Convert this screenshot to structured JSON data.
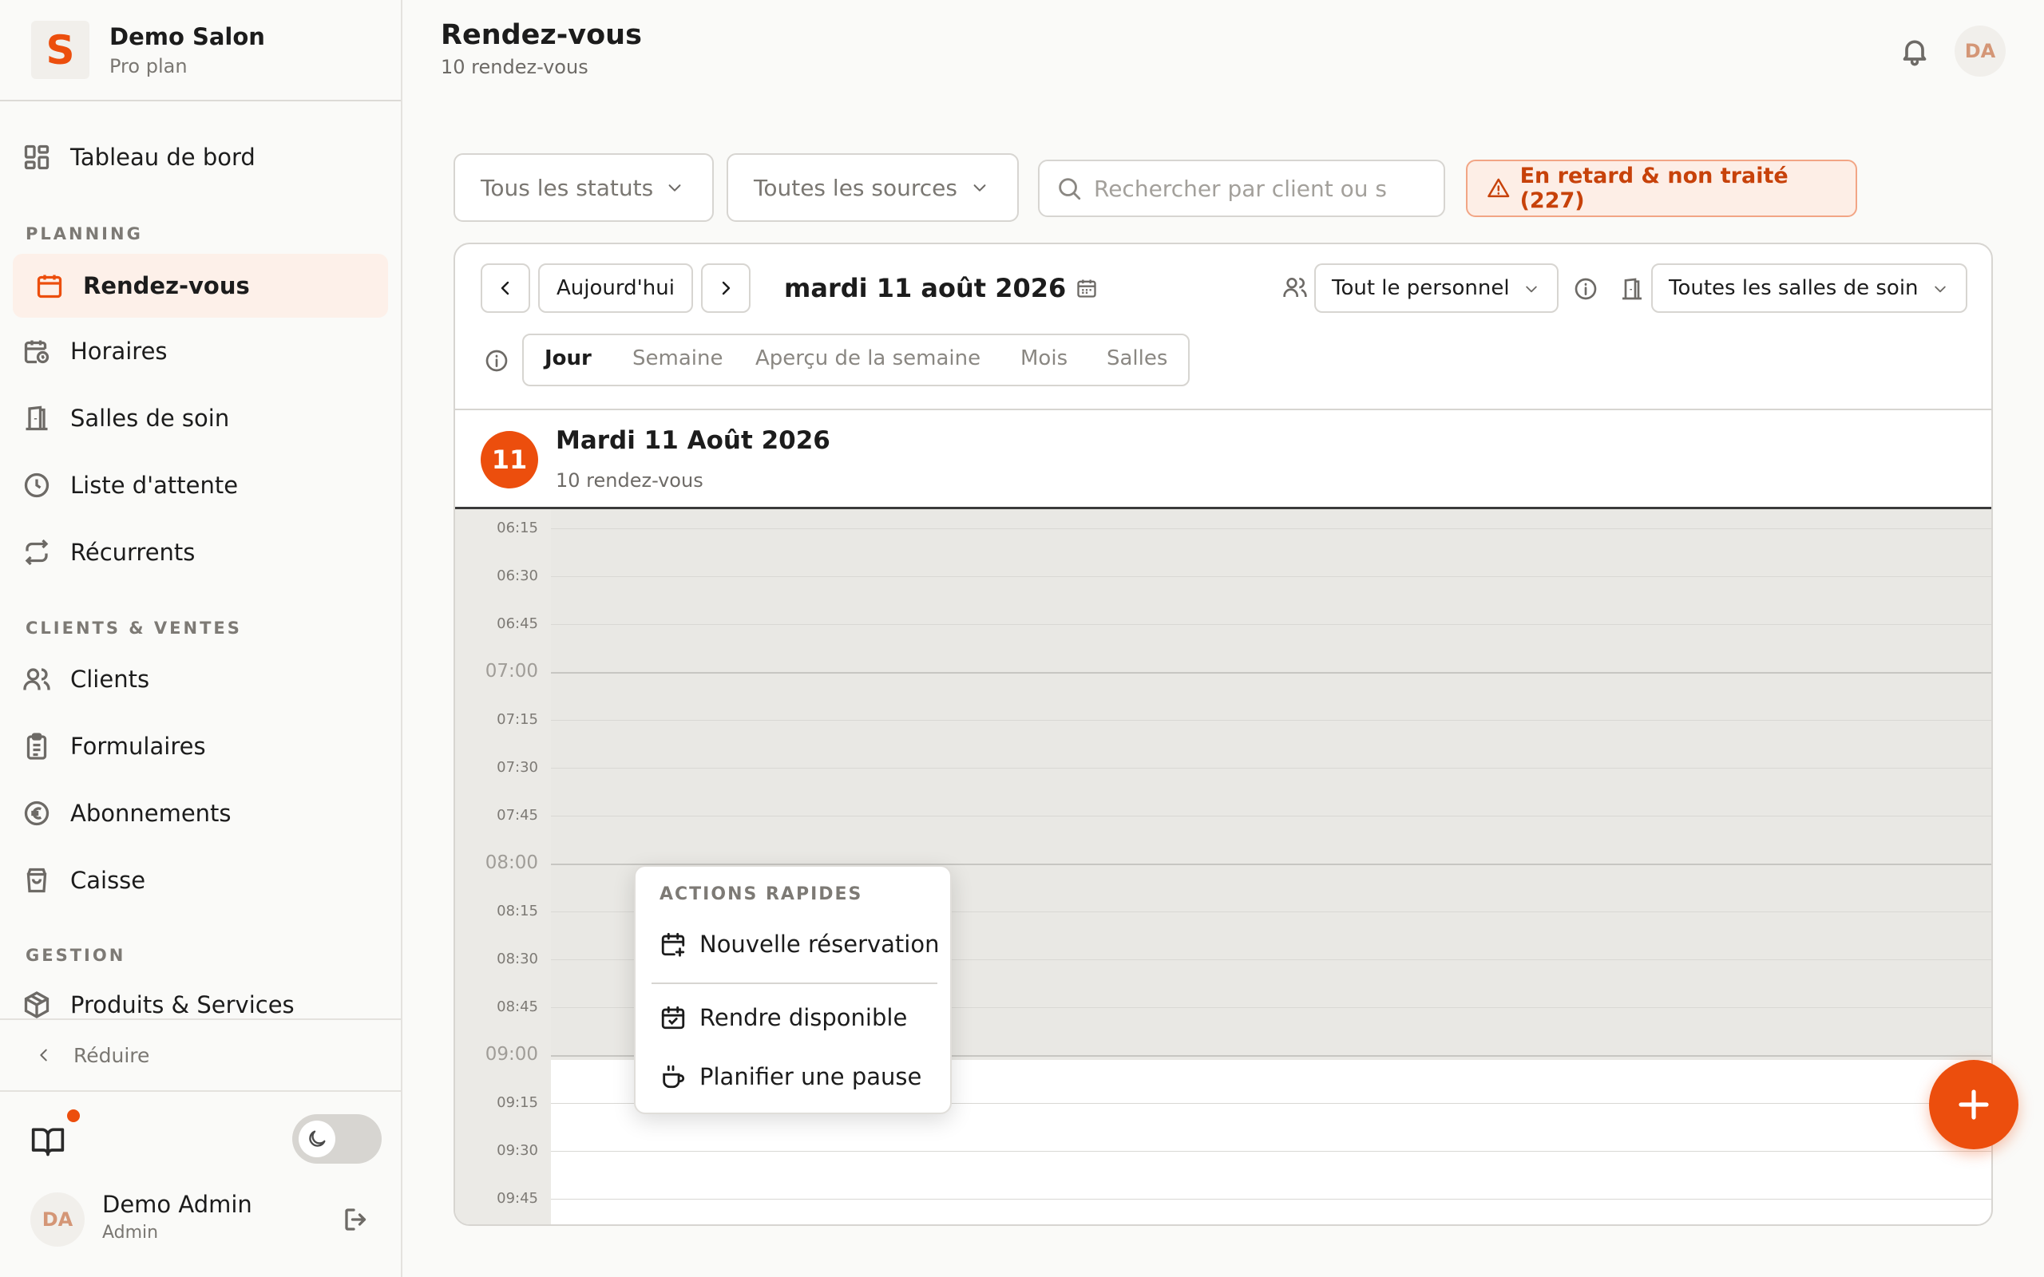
{
  "brand": {
    "logo_letter": "S",
    "name": "Demo Salon",
    "plan": "Pro plan"
  },
  "sidebar": {
    "top_item": {
      "label": "Tableau de bord",
      "icon": "dashboard-icon"
    },
    "sections": [
      {
        "title": "PLANNING",
        "items": [
          {
            "label": "Rendez-vous",
            "icon": "calendar-icon",
            "active": true
          },
          {
            "label": "Horaires",
            "icon": "calendar-clock-icon"
          },
          {
            "label": "Salles de soin",
            "icon": "door-icon"
          },
          {
            "label": "Liste d'attente",
            "icon": "clock-icon"
          },
          {
            "label": "Récurrents",
            "icon": "repeat-icon"
          }
        ]
      },
      {
        "title": "CLIENTS & VENTES",
        "items": [
          {
            "label": "Clients",
            "icon": "users-icon"
          },
          {
            "label": "Formulaires",
            "icon": "clipboard-icon"
          },
          {
            "label": "Abonnements",
            "icon": "euro-icon"
          },
          {
            "label": "Caisse",
            "icon": "shopping-bag-icon"
          }
        ]
      },
      {
        "title": "GESTION",
        "items": [
          {
            "label": "Produits & Services",
            "icon": "package-icon"
          }
        ]
      }
    ],
    "collapse_label": "Réduire",
    "user": {
      "initials": "DA",
      "name": "Demo Admin",
      "role": "Admin"
    }
  },
  "header": {
    "title": "Rendez-vous",
    "subtitle": "10 rendez-vous",
    "avatar_initials": "DA"
  },
  "filters": {
    "status": "Tous les statuts",
    "source": "Toutes les sources",
    "search_placeholder": "Rechercher par client ou s",
    "late_label": "En retard & non traité (227)"
  },
  "calendar": {
    "today_label": "Aujourd'hui",
    "date_label": "mardi 11 août 2026",
    "staff_select": "Tout le personnel",
    "room_select": "Toutes les salles de soin",
    "views": [
      "Jour",
      "Semaine",
      "Aperçu de la semaine",
      "Mois",
      "Salles"
    ],
    "active_view": "Jour",
    "day": {
      "number": "11",
      "title": "Mardi 11 Août 2026",
      "subtitle": "10 rendez-vous"
    },
    "slots": [
      "06:15",
      "06:30",
      "06:45",
      "07:00",
      "07:15",
      "07:30",
      "07:45",
      "08:00",
      "08:15",
      "08:30",
      "08:45",
      "09:00",
      "09:15",
      "09:30",
      "09:45"
    ]
  },
  "quick_actions": {
    "title": "ACTIONS RAPIDES",
    "items": [
      "Nouvelle réservation",
      "Rendre disponible",
      "Planifier une pause"
    ]
  },
  "colors": {
    "accent": "#ec4e0d",
    "accent_soft": "#fdf0e9",
    "unavailable": "#e9e8e4"
  }
}
